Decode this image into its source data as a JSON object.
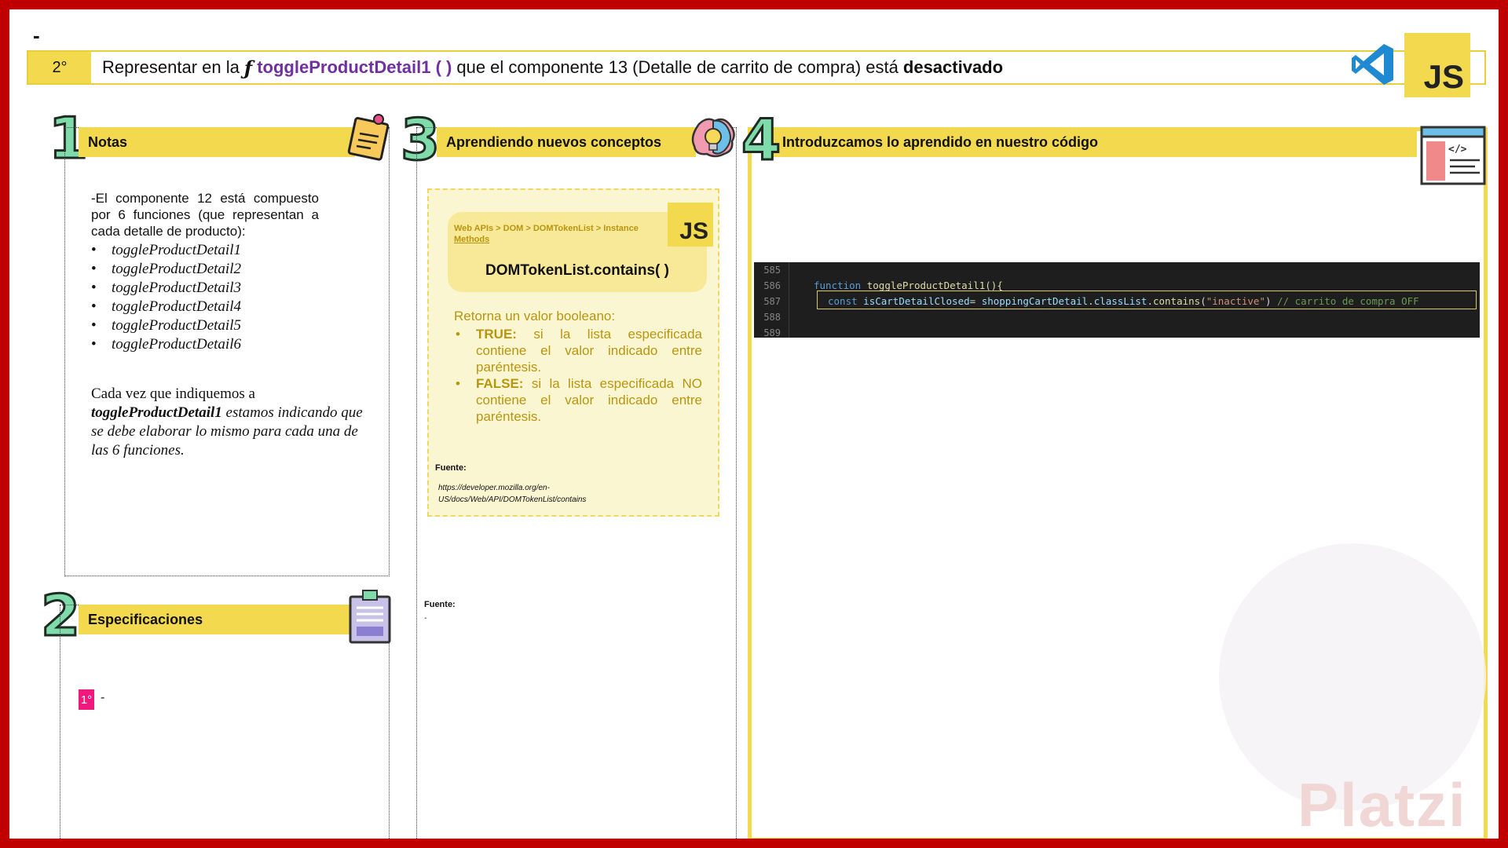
{
  "top_dash": "-",
  "header": {
    "step": "2°",
    "text_before": "Representar en la",
    "fx_symbol": "ƒ",
    "function_name": "toggleProductDetail1 ( )",
    "text_middle": "que el componente 13 (Detalle de carrito de compra) está",
    "text_bold": "desactivado"
  },
  "logos": {
    "js": "JS",
    "vscode": "vscode-icon"
  },
  "panels": {
    "notes": {
      "number": "1",
      "title": "Notas",
      "intro": "-El componente 12 está compuesto por 6 funciones (que representan a cada detalle de producto):",
      "items": [
        "toggleProductDetail1",
        "toggleProductDetail2",
        "toggleProductDetail3",
        "toggleProductDetail4",
        "toggleProductDetail5",
        "toggleProductDetail6"
      ],
      "bullet": "•",
      "para_start": "Cada vez que indiquemos a",
      "para_bold": "toggleProductDetail1",
      "para_end": "estamos indicando que se debe elaborar lo mismo para cada una de las 6 funciones."
    },
    "specs": {
      "number": "2",
      "title": "Especificaciones",
      "badge": "1°",
      "dash": "-"
    },
    "concepts": {
      "number": "3",
      "title": "Aprendiendo nuevos conceptos",
      "breadcrumb_path": "Web APIs > DOM > DOMTokenList > Instance",
      "breadcrumb_link": "Methods",
      "js": "JS",
      "method": "DOMTokenList.contains( )",
      "desc_intro": "Retorna un valor booleano:",
      "desc_items": [
        {
          "bold": "TRUE:",
          "text": "si la lista especificada contiene el valor indicado entre paréntesis."
        },
        {
          "bold": "FALSE:",
          "text": "si la lista especificada NO contiene el valor indicado entre paréntesis."
        }
      ],
      "source_label": "Fuente:",
      "source_url": "https://developer.mozilla.org/en-US/docs/Web/API/DOMTokenList/contains",
      "source2_label": "Fuente:",
      "source2_value": "-"
    },
    "code": {
      "number": "4",
      "title": "Introduzcamos lo aprendido en nuestro código",
      "line_numbers": [
        "585",
        "586",
        "587",
        "588",
        "589"
      ],
      "line586": {
        "kw": "function",
        "name": "toggleProductDetail1",
        "rest": "(){"
      },
      "line587": {
        "kw": "const",
        "var": "isCartDetailClosed",
        "eq": "=",
        "obj": "shoppingCartDetail",
        "dot1": ".",
        "prop": "classList",
        "dot2": ".",
        "method": "contains",
        "open": "(",
        "str": "\"inactive\"",
        "close": ")",
        "comment": "// carrito de compra OFF"
      }
    }
  },
  "watermark": {
    "brand": "Platzi"
  },
  "colors": {
    "border": "#c00000",
    "yellow": "#f2d94e",
    "purple": "#7030a0",
    "gold_text": "#b8950f",
    "number_green": "#7fdcaa",
    "pink_badge": "#f0197d"
  }
}
